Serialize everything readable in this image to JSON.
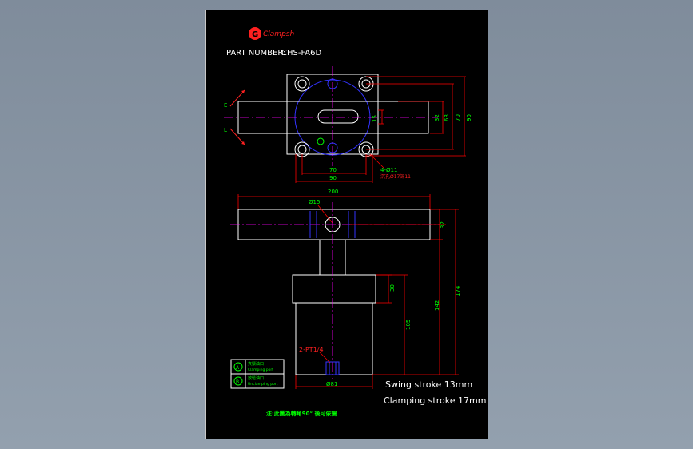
{
  "brand": {
    "logo_text": "Clampsh",
    "logo_mark": "G"
  },
  "part": {
    "label": "PART NUMBER:",
    "number": "CHS-FA6D"
  },
  "top_view": {
    "dim_left_label": "E",
    "dim_left_label2": "L",
    "dimensions": {
      "width_inner": "70",
      "width_outer": "90",
      "height_15": "15",
      "height_32": "32",
      "height_63": "63",
      "height_70": "70",
      "height_90": "90"
    },
    "hole_note_line1": "4-Ø11",
    "hole_note_line2": "沉孔Ø17深11"
  },
  "side_view": {
    "dimensions": {
      "length": "200",
      "pin_dia": "Ø15",
      "arm_height": "32",
      "flange_height": "30",
      "body_height": "105",
      "total_142": "142",
      "total_174": "174",
      "body_dia": "Ø81"
    },
    "port_label": "2-PT1/4"
  },
  "legend": {
    "rows": [
      {
        "symbol": "A",
        "cn": "夾緊油口",
        "en": "Clamping port"
      },
      {
        "symbol": "B",
        "cn": "放鬆油口",
        "en": "Unclamping port"
      }
    ]
  },
  "specs": {
    "swing_stroke": "Swing stroke 13mm",
    "clamping_stroke": "Clamping stroke 17mm"
  },
  "note": "注:此圖為轉角90° 後可依需",
  "colors": {
    "background": "#8a97a5",
    "sheet": "#000000",
    "outline": "#ffffff",
    "dimension": "#ff0000",
    "center_line": "#ff00ff",
    "hidden": "#3333ff",
    "text_green": "#00ff00",
    "logo_red": "#ff2020"
  }
}
